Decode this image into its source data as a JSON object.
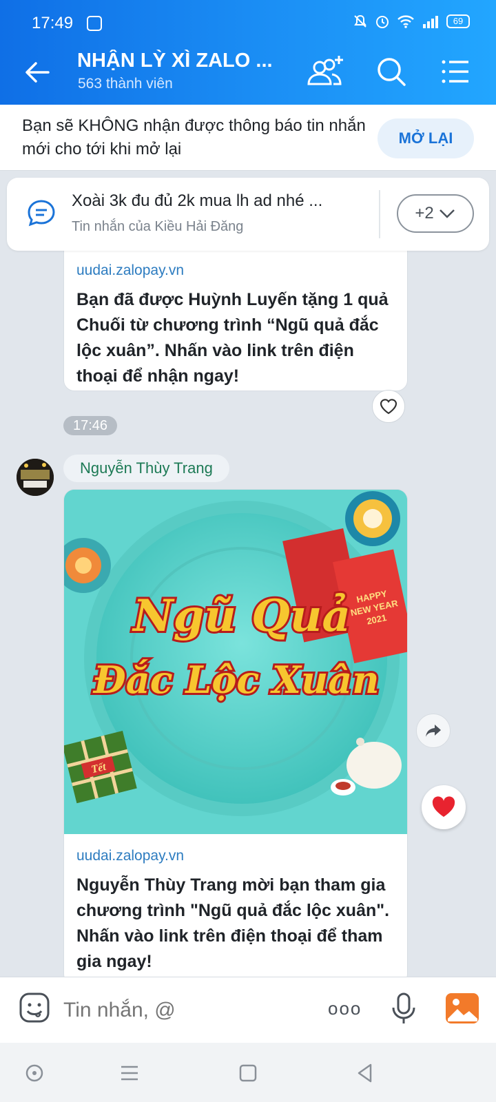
{
  "status": {
    "time": "17:49",
    "battery": "69"
  },
  "header": {
    "title": "NHẬN LỲ XÌ ZALO ...",
    "subtitle": "563 thành viên"
  },
  "notice": {
    "text": "Bạn sẽ KHÔNG nhận được thông báo tin nhắn mới cho tới khi mở lại",
    "button": "MỞ LẠI"
  },
  "pinned": {
    "text": "Xoài 3k đu đủ 2k mua lh ad nhé ...",
    "sub": "Tin nhắn của Kiều Hải Đăng",
    "more": "+2"
  },
  "messages": [
    {
      "domain": "uudai.zalopay.vn",
      "text": "Bạn đã được Huỳnh Luyến tặng 1 quả Chuối từ chương trình “Ngũ quả đắc lộc xuân”. Nhấn vào link trên điện thoại để nhận ngay!",
      "time": "17:46"
    },
    {
      "sender": "Nguyễn Thùy Trang",
      "image_text_1": "Ngũ Quả",
      "image_text_2": "Đắc Lộc Xuân",
      "image_tag": "Tết",
      "image_envelope": "HAPPY NEW YEAR 2021",
      "domain": "uudai.zalopay.vn",
      "text": "Nguyễn Thùy Trang mời bạn tham gia chương trình \"Ngũ quả đắc lộc xuân\". Nhấn vào link trên điện thoại để tham gia ngay!"
    }
  ],
  "input": {
    "placeholder": "Tin nhắn, @",
    "more": "ooo"
  },
  "colors": {
    "header_start": "#0f6fe6",
    "header_end": "#22a6ff",
    "link": "#2d7cc0",
    "sender": "#1d7a55",
    "heart": "#e8232f"
  }
}
